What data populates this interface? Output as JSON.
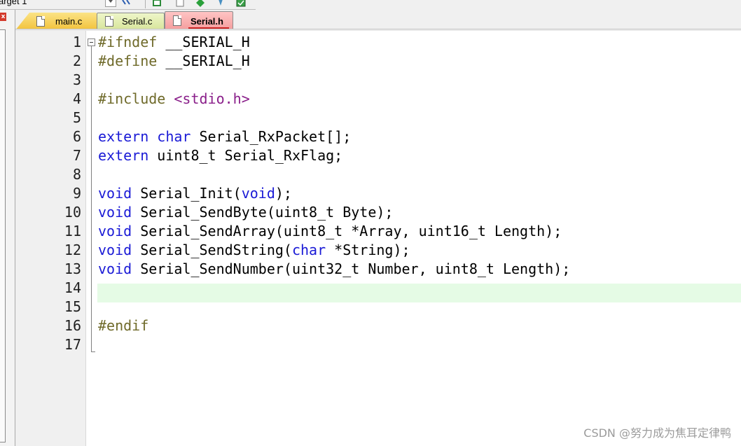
{
  "toolbar": {
    "target_label": "arget 1"
  },
  "left_panel": {
    "close_glyph": "x"
  },
  "tabs": [
    {
      "label": "main.c",
      "active": false
    },
    {
      "label": "Serial.c",
      "active": false
    },
    {
      "label": "Serial.h",
      "active": true
    }
  ],
  "editor": {
    "current_line": 14,
    "lines": [
      {
        "num": "1",
        "tokens": [
          {
            "t": "#ifndef",
            "c": "pp"
          },
          {
            "t": " __SERIAL_H",
            "c": "plain"
          }
        ]
      },
      {
        "num": "2",
        "tokens": [
          {
            "t": "#define",
            "c": "pp"
          },
          {
            "t": " __SERIAL_H",
            "c": "plain"
          }
        ]
      },
      {
        "num": "3",
        "tokens": []
      },
      {
        "num": "4",
        "tokens": [
          {
            "t": "#include",
            "c": "pp"
          },
          {
            "t": " ",
            "c": "plain"
          },
          {
            "t": "<stdio.h>",
            "c": "str"
          }
        ]
      },
      {
        "num": "5",
        "tokens": []
      },
      {
        "num": "6",
        "tokens": [
          {
            "t": "extern",
            "c": "kw"
          },
          {
            "t": " ",
            "c": "plain"
          },
          {
            "t": "char",
            "c": "kw"
          },
          {
            "t": " Serial_RxPacket[];",
            "c": "plain"
          }
        ]
      },
      {
        "num": "7",
        "tokens": [
          {
            "t": "extern",
            "c": "kw"
          },
          {
            "t": " uint8_t Serial_RxFlag;",
            "c": "plain"
          }
        ]
      },
      {
        "num": "8",
        "tokens": []
      },
      {
        "num": "9",
        "tokens": [
          {
            "t": "void",
            "c": "kw"
          },
          {
            "t": " Serial_Init(",
            "c": "plain"
          },
          {
            "t": "void",
            "c": "kw"
          },
          {
            "t": ");",
            "c": "plain"
          }
        ]
      },
      {
        "num": "10",
        "tokens": [
          {
            "t": "void",
            "c": "kw"
          },
          {
            "t": " Serial_SendByte(uint8_t Byte);",
            "c": "plain"
          }
        ]
      },
      {
        "num": "11",
        "tokens": [
          {
            "t": "void",
            "c": "kw"
          },
          {
            "t": " Serial_SendArray(uint8_t *Array, uint16_t Length);",
            "c": "plain"
          }
        ]
      },
      {
        "num": "12",
        "tokens": [
          {
            "t": "void",
            "c": "kw"
          },
          {
            "t": " Serial_SendString(",
            "c": "plain"
          },
          {
            "t": "char",
            "c": "kw"
          },
          {
            "t": " *String);",
            "c": "plain"
          }
        ]
      },
      {
        "num": "13",
        "tokens": [
          {
            "t": "void",
            "c": "kw"
          },
          {
            "t": " Serial_SendNumber(uint32_t Number, uint8_t Length);",
            "c": "plain"
          }
        ]
      },
      {
        "num": "14",
        "tokens": []
      },
      {
        "num": "15",
        "tokens": []
      },
      {
        "num": "16",
        "tokens": [
          {
            "t": "#endif",
            "c": "pp"
          }
        ]
      },
      {
        "num": "17",
        "tokens": []
      }
    ]
  },
  "colors": {
    "preprocessor": "#6f6a2a",
    "keyword": "#1a1ad6",
    "string": "#8a1f8a",
    "current_line_bg": "#e5fbe5"
  },
  "watermark": "CSDN @努力成为焦耳定律鸭"
}
